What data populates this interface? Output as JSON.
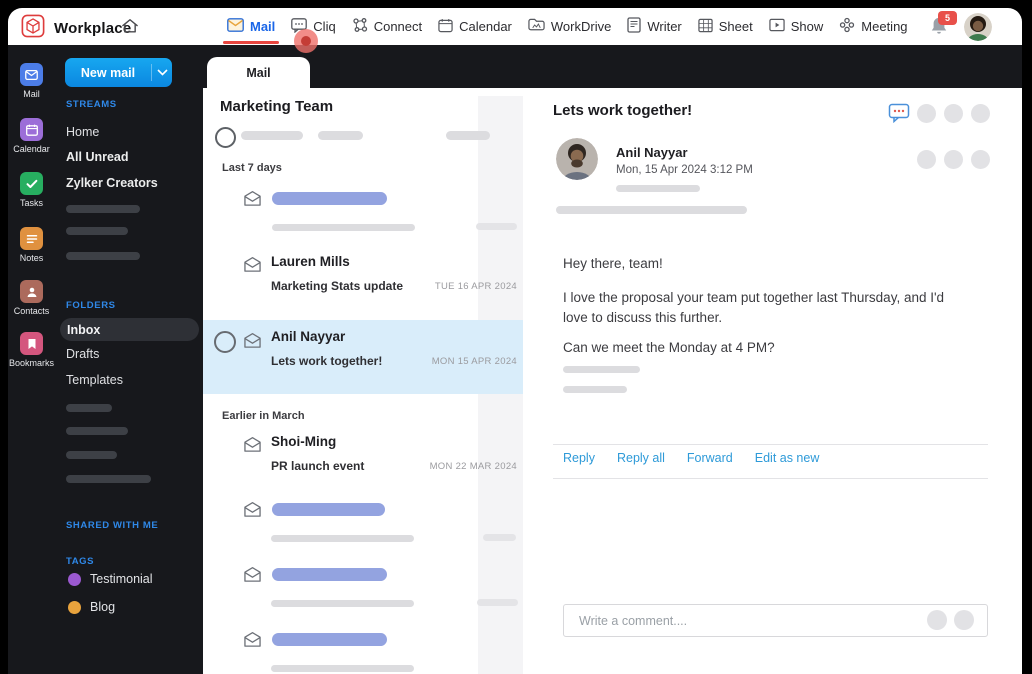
{
  "colors": {
    "accent_blue": "#1a66e8",
    "active_underline_red": "#e8453f",
    "new_mail_button_blue": "#0f9bea",
    "section_label_blue": "#2f88e8",
    "selected_mail_bg": "#d9edfa",
    "unread_bar_blue": "#93a3e0",
    "notification_badge_red": "#e8504a"
  },
  "topbar": {
    "brand": "Workplace",
    "nav": [
      {
        "label": "Mail",
        "active": true
      },
      {
        "label": "Cliq"
      },
      {
        "label": "Connect"
      },
      {
        "label": "Calendar"
      },
      {
        "label": "WorkDrive"
      },
      {
        "label": "Writer"
      },
      {
        "label": "Sheet"
      },
      {
        "label": "Show"
      },
      {
        "label": "Meeting"
      }
    ],
    "notification_count": "5"
  },
  "rail": {
    "items": [
      {
        "label": "Mail",
        "color": "#4c7de8"
      },
      {
        "label": "Calendar",
        "color": "#9c6ed8"
      },
      {
        "label": "Tasks",
        "color": "#27ae60"
      },
      {
        "label": "Notes",
        "color": "#e0913f"
      },
      {
        "label": "Contacts",
        "color": "#ac6a5c"
      },
      {
        "label": "Bookmarks",
        "color": "#d4567e"
      }
    ]
  },
  "sidebar": {
    "new_mail_label": "New mail",
    "streams_label": "STREAMS",
    "streams": [
      "Home",
      "All Unread",
      "Zylker Creators"
    ],
    "folders_label": "FOLDERS",
    "folders": [
      "Inbox",
      "Drafts",
      "Templates"
    ],
    "selected_folder": "Inbox",
    "shared_label": "SHARED WITH ME",
    "tags_label": "TAGS",
    "tags": [
      {
        "name": "Testimonial",
        "color": "#9b59d0"
      },
      {
        "name": "Blog",
        "color": "#e8a33d"
      }
    ]
  },
  "list": {
    "tab_label": "Mail",
    "title": "Marketing Team",
    "section_recent": "Last 7 days",
    "section_earlier": "Earlier in March",
    "items": [
      {
        "sender": "Lauren Mills",
        "subject": "Marketing Stats update",
        "date": "TUE 16 APR 2024"
      },
      {
        "sender": "Anil Nayyar",
        "subject": "Lets work together!",
        "date": "MON 15 APR 2024",
        "selected": true
      },
      {
        "sender": "Shoi-Ming",
        "subject": "PR launch event",
        "date": "MON 22 MAR 2024"
      }
    ]
  },
  "reader": {
    "title": "Lets work together!",
    "sender_name": "Anil Nayyar",
    "sent_datetime": "Mon,  15 Apr 2024  3:12 PM",
    "body_paragraphs": [
      "Hey there, team!",
      "I love the proposal your team put together last Thursday, and I'd love to discuss this further.",
      "Can we meet the Monday at 4 PM?"
    ],
    "actions": [
      "Reply",
      "Reply all",
      "Forward",
      "Edit as new"
    ],
    "comment_placeholder": "Write a comment...."
  }
}
